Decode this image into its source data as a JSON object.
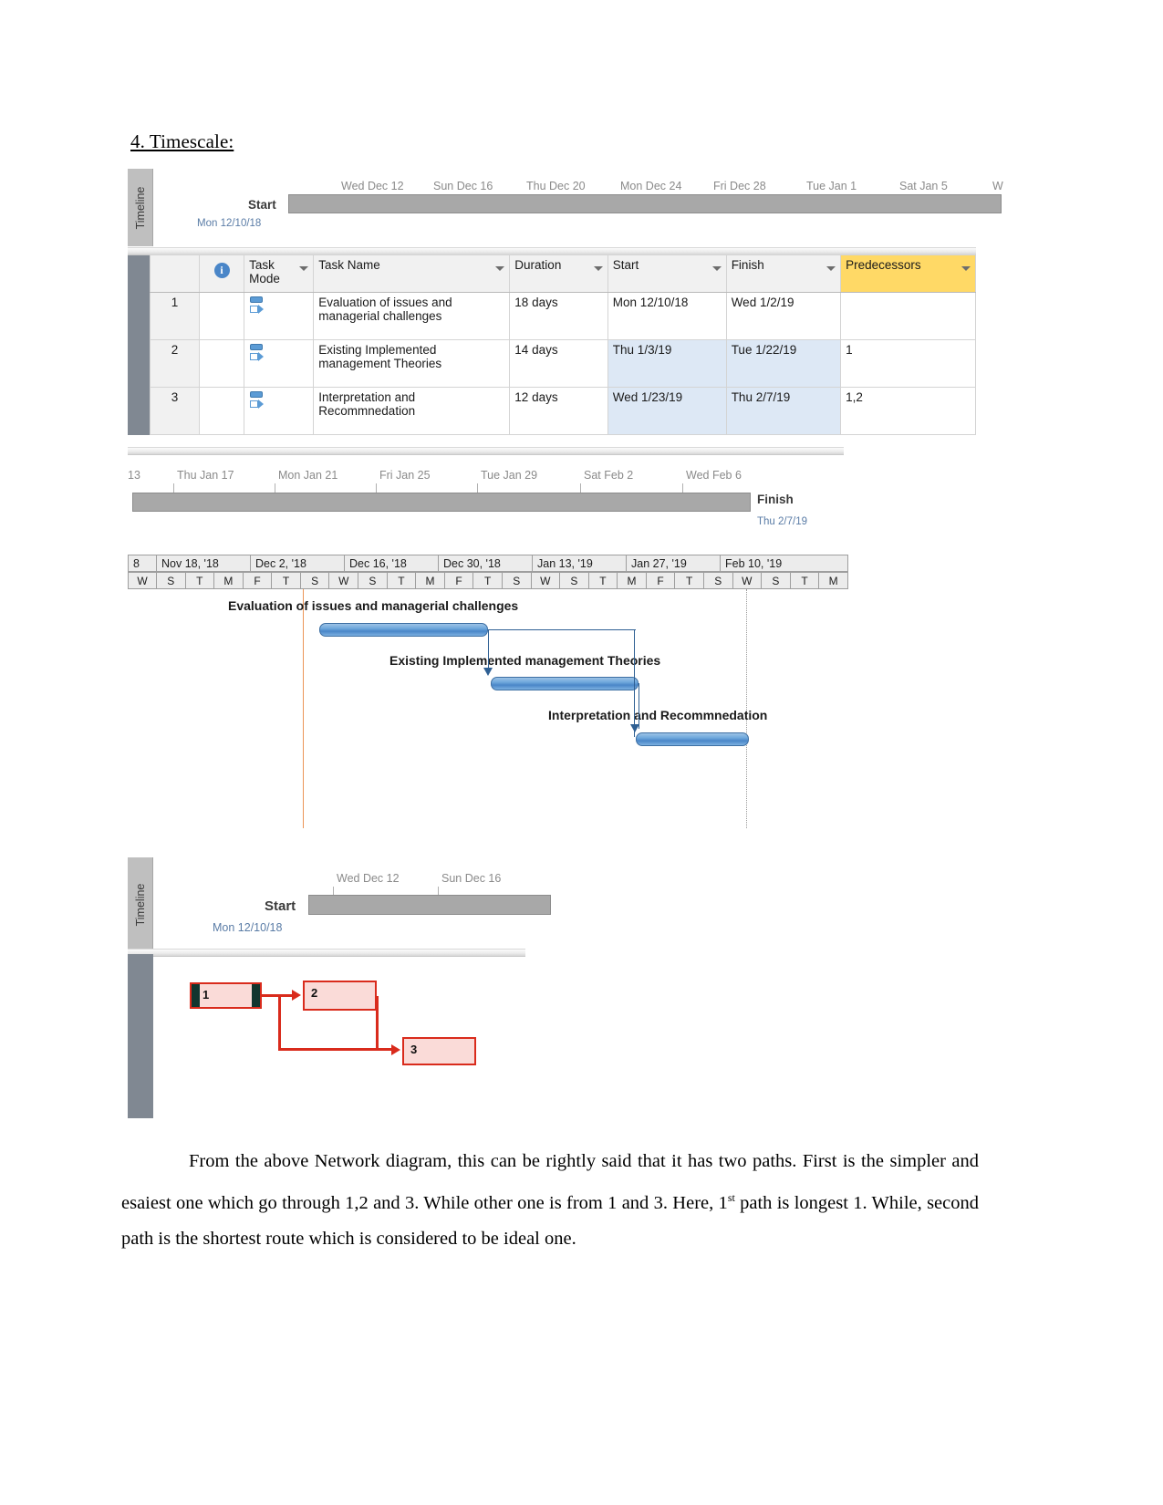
{
  "heading": "4. Timescale:",
  "timeline_top": {
    "sidebar_label": "Timeline",
    "start_label": "Start",
    "start_date": "Mon 12/10/18",
    "ticks": [
      "Wed Dec 12",
      "Sun Dec 16",
      "Thu Dec 20",
      "Mon Dec 24",
      "Fri Dec 28",
      "Tue Jan 1",
      "Sat Jan 5",
      "W"
    ]
  },
  "table": {
    "columns": [
      "",
      "",
      "Task Mode",
      "Task Name",
      "Duration",
      "Start",
      "Finish",
      "Predecessors"
    ],
    "info_icon": "info-icon",
    "rows": [
      {
        "id": "1",
        "mode": "auto-scheduled-icon",
        "name": "Evaluation of issues and managerial challenges",
        "duration": "18 days",
        "start": "Mon 12/10/18",
        "finish": "Wed 1/2/19",
        "predecessors": ""
      },
      {
        "id": "2",
        "mode": "auto-scheduled-icon",
        "name": "Existing Implemented management Theories",
        "duration": "14 days",
        "start": "Thu 1/3/19",
        "finish": "Tue 1/22/19",
        "predecessors": "1"
      },
      {
        "id": "3",
        "mode": "auto-scheduled-icon",
        "name": "Interpretation and Recommnedation",
        "duration": "12 days",
        "start": "Wed 1/23/19",
        "finish": "Thu 2/7/19",
        "predecessors": "1,2"
      }
    ]
  },
  "timeline_bottom_strip": {
    "leading": "13",
    "ticks": [
      "Thu Jan 17",
      "Mon Jan 21",
      "Fri Jan 25",
      "Tue Jan 29",
      "Sat Feb 2",
      "Wed Feb 6"
    ],
    "finish_label": "Finish",
    "finish_date": "Thu 2/7/19"
  },
  "gantt": {
    "week_headers": [
      "8",
      "Nov 18, '18",
      "Dec 2, '18",
      "Dec 16, '18",
      "Dec 30, '18",
      "Jan 13, '19",
      "Jan 27, '19",
      "Feb 10, '19"
    ],
    "day_letters": [
      "W",
      "S",
      "T",
      "M",
      "F",
      "T",
      "S",
      "W",
      "S",
      "T",
      "M",
      "F",
      "T",
      "S",
      "W",
      "S",
      "T",
      "M",
      "F",
      "T",
      "S",
      "W",
      "S",
      "T",
      "M"
    ],
    "bars": [
      {
        "label": "Evaluation of issues and managerial challenges",
        "task": "1"
      },
      {
        "label": "Existing Implemented management Theories",
        "task": "2"
      },
      {
        "label": "Interpretation and Recommnedation",
        "task": "3"
      }
    ]
  },
  "timeline_network": {
    "sidebar_label": "Timeline",
    "start_label": "Start",
    "start_date": "Mon 12/10/18",
    "ticks": [
      "Wed Dec 12",
      "Sun Dec 16"
    ]
  },
  "network": {
    "nodes": [
      {
        "id": "1",
        "critical": true
      },
      {
        "id": "2",
        "critical": false
      },
      {
        "id": "3",
        "critical": false
      }
    ]
  },
  "paragraph": {
    "text_1": "From the above Network diagram, this can be rightly said that it has two paths. First is the simpler and esaiest one which go through 1,2 and 3. While other one is from 1 and 3. Here, 1",
    "sup": "st",
    "text_2": " path is longest 1. While, second path is the shortest route which is considered to be ideal one."
  },
  "colors": {
    "predecessor_header": "#ffd966",
    "gantt_bar": "#4a86c8",
    "network_border": "#d92b1c",
    "network_fill": "#fadbd8",
    "critical_marker": "#11352f",
    "today_line": "#e8833a"
  }
}
